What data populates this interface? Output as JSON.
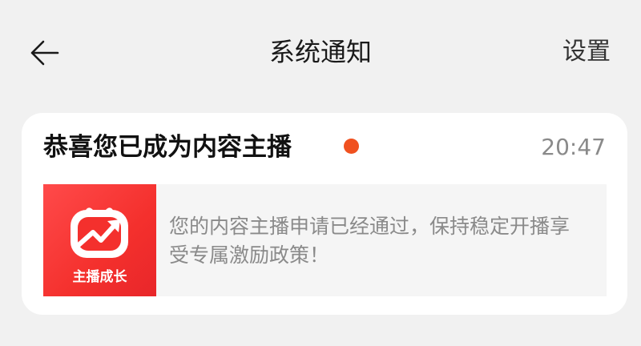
{
  "header": {
    "back_icon": "arrow-left-icon",
    "title": "系统通知",
    "settings_label": "设置"
  },
  "notification": {
    "title": "恭喜您已成为内容主播",
    "unread": true,
    "unread_color": "#f0511f",
    "time": "20:47",
    "thumbnail": {
      "icon": "growth-chart-logo-icon",
      "label": "主播成长",
      "color": "#f4302d"
    },
    "message": "您的内容主播申请已经通过，保持稳定开播享受专属激励政策！"
  }
}
